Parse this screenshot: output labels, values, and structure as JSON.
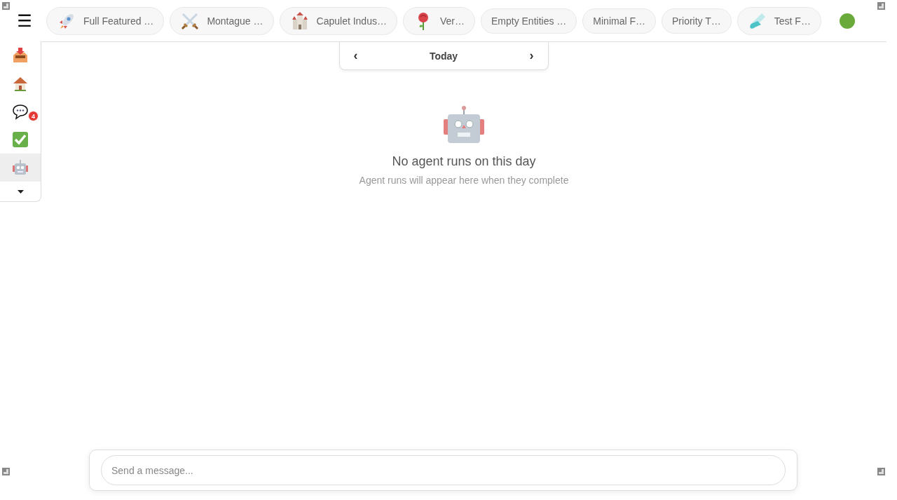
{
  "menu_button": "☰",
  "tabs": [
    {
      "label": "Full Featured …",
      "selected": false
    },
    {
      "label": "Montague …",
      "selected": false
    },
    {
      "label": "Capulet Indus…",
      "selected": false
    },
    {
      "label": "Ver…",
      "selected": false
    },
    {
      "label": "Empty Entities …",
      "selected": false
    },
    {
      "label": "Minimal F…",
      "selected": false
    },
    {
      "label": "Priority T…",
      "selected": false
    },
    {
      "label": "Test F…",
      "selected": false
    }
  ],
  "status": {
    "color": "#6aaa3a"
  },
  "sidebar": {
    "items": [
      {
        "selected": false
      },
      {
        "selected": false
      },
      {
        "selected": false,
        "badge": "4"
      },
      {
        "selected": false
      },
      {
        "selected": true
      }
    ]
  },
  "day_nav": {
    "prev": "‹",
    "label": "Today",
    "next": "›"
  },
  "empty_state": {
    "title": "No agent runs on this day",
    "subtitle": "Agent runs will appear here when they complete"
  },
  "composer": {
    "placeholder": "Send a message..."
  }
}
